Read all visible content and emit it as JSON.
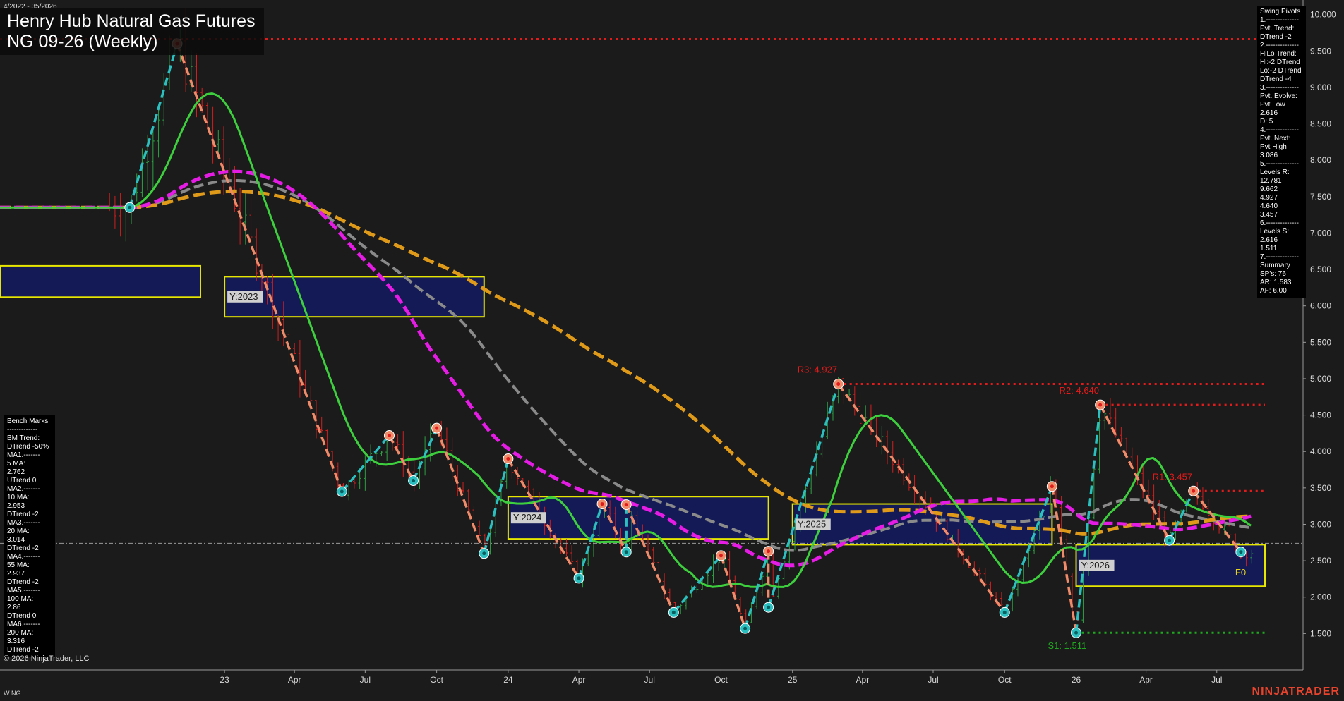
{
  "header": {
    "date_range": "4/2022 - 35/2026",
    "title_line1": "Henry Hub Natural Gas Futures",
    "title_line2": "NG 09-26 (Weekly)"
  },
  "footer": {
    "copyright": "© 2026 NinjaTrader, LLC",
    "instrument_tag": "W NG",
    "brand": "NINJATRADER"
  },
  "swing_pivots_panel": {
    "lines": [
      "Swing Pivots",
      "1.--------------",
      "Pvt. Trend:",
      "DTrend -2",
      "2.--------------",
      "HiLo Trend:",
      "Hi:-2 DTrend",
      "Lo:-2 DTrend",
      "DTrend -4",
      "3.--------------",
      "Pvt. Evolve:",
      "Pvt Low",
      "2.616",
      "D: 5",
      "4.--------------",
      "Pvt. Next:",
      "Pvt High",
      "3.086",
      "5.--------------",
      "Levels R:",
      "12.781",
      "9.662",
      "4.927",
      "4.640",
      "3.457",
      "6.--------------",
      "Levels S:",
      "2.616",
      "1.511",
      "7.--------------",
      "Summary",
      "SP's: 76",
      "AR: 1.583",
      "AF: 6.00"
    ]
  },
  "bench_marks_panel": {
    "lines": [
      "Bench Marks",
      "-------------",
      "BM Trend:",
      "DTrend -50%",
      "MA1.-------",
      "5 MA:",
      "2.762",
      "UTrend 0",
      "MA2.-------",
      "10 MA:",
      "2.953",
      "DTrend -2",
      "MA3.-------",
      "20 MA:",
      "3.014",
      "DTrend -2",
      "MA4.-------",
      "55 MA:",
      "2.937",
      "DTrend -2",
      "MA5.-------",
      "100 MA:",
      "2.86",
      "DTrend 0",
      "MA6.-------",
      "200 MA:",
      "3.316",
      "DTrend -2"
    ]
  },
  "chart_data": {
    "type": "candlestick",
    "x_ticks": [
      {
        "label": "23",
        "date": "2023-01"
      },
      {
        "label": "Apr",
        "date": "2023-04"
      },
      {
        "label": "Jul",
        "date": "2023-07"
      },
      {
        "label": "Oct",
        "date": "2023-10"
      },
      {
        "label": "24",
        "date": "2024-01"
      },
      {
        "label": "Apr",
        "date": "2024-04"
      },
      {
        "label": "Jul",
        "date": "2024-07"
      },
      {
        "label": "Oct",
        "date": "2024-10"
      },
      {
        "label": "25",
        "date": "2025-01"
      },
      {
        "label": "Apr",
        "date": "2025-04"
      },
      {
        "label": "Jul",
        "date": "2025-07"
      },
      {
        "label": "Oct",
        "date": "2025-10"
      },
      {
        "label": "26",
        "date": "2026-01"
      },
      {
        "label": "Apr",
        "date": "2026-04"
      },
      {
        "label": "Jul",
        "date": "2026-07"
      }
    ],
    "y_ticks": [
      "10.000",
      "9.500",
      "9.000",
      "8.500",
      "8.000",
      "7.500",
      "7.000",
      "6.500",
      "6.000",
      "5.500",
      "5.000",
      "4.500",
      "4.000",
      "3.500",
      "3.000",
      "2.500",
      "2.000",
      "1.500"
    ],
    "y_range": [
      1.0,
      10.2
    ],
    "last_price": 2.74,
    "swing_points": [
      {
        "date": "2022-09",
        "price": 7.35,
        "type": "low"
      },
      {
        "date": "2022-11",
        "price": 9.6,
        "type": "high"
      },
      {
        "date": "2023-06",
        "price": 3.45,
        "type": "low"
      },
      {
        "date": "2023-08",
        "price": 4.22,
        "type": "high"
      },
      {
        "date": "2023-09",
        "price": 3.6,
        "type": "low"
      },
      {
        "date": "2023-10",
        "price": 4.32,
        "type": "high"
      },
      {
        "date": "2023-12",
        "price": 2.6,
        "type": "low"
      },
      {
        "date": "2024-01",
        "price": 3.9,
        "type": "high"
      },
      {
        "date": "2024-04",
        "price": 2.26,
        "type": "low"
      },
      {
        "date": "2024-05",
        "price": 3.28,
        "type": "high"
      },
      {
        "date": "2024-06",
        "price": 2.62,
        "type": "low"
      },
      {
        "date": "2024-06",
        "price": 3.27,
        "type": "high"
      },
      {
        "date": "2024-08",
        "price": 1.79,
        "type": "low"
      },
      {
        "date": "2024-10",
        "price": 2.57,
        "type": "high"
      },
      {
        "date": "2024-11",
        "price": 1.57,
        "type": "low"
      },
      {
        "date": "2024-12",
        "price": 2.63,
        "type": "high"
      },
      {
        "date": "2024-12",
        "price": 1.86,
        "type": "low"
      },
      {
        "date": "2025-03",
        "price": 4.927,
        "type": "high"
      },
      {
        "date": "2025-10",
        "price": 1.79,
        "type": "low"
      },
      {
        "date": "2025-12",
        "price": 3.52,
        "type": "high"
      },
      {
        "date": "2026-01",
        "price": 1.511,
        "type": "low"
      },
      {
        "date": "2026-02",
        "price": 4.64,
        "type": "high"
      },
      {
        "date": "2026-05",
        "price": 2.78,
        "type": "low"
      },
      {
        "date": "2026-06",
        "price": 3.457,
        "type": "high"
      },
      {
        "date": "2026-08",
        "price": 2.62,
        "type": "low"
      }
    ],
    "resistance_levels": [
      {
        "label": "R3: 4.927",
        "value": 4.927
      },
      {
        "label": "R2: 4.640",
        "value": 4.64
      },
      {
        "label": "R1: 3.457",
        "value": 3.457
      }
    ],
    "top_resistance_value": 9.662,
    "support_levels": [
      {
        "label": "S1: 1.511",
        "value": 1.511
      }
    ],
    "yearly_boxes": [
      {
        "label": "",
        "date_start": "2022-04",
        "date_end": "2022-12",
        "high": 6.55,
        "low": 6.12
      },
      {
        "label": "Y:2023",
        "date_start": "2023-01",
        "date_end": "2023-12",
        "high": 6.4,
        "low": 5.85
      },
      {
        "label": "Y:2024",
        "date_start": "2024-01",
        "date_end": "2024-12",
        "high": 3.38,
        "low": 2.8
      },
      {
        "label": "Y:2025",
        "date_start": "2025-01",
        "date_end": "2025-12",
        "high": 3.28,
        "low": 2.72
      },
      {
        "label": "Y:2026",
        "date_start": "2026-01",
        "date_end": "2026-09",
        "high": 2.72,
        "low": 2.15
      }
    ],
    "forecast_marker": {
      "label": "F0",
      "date": "2026-08"
    },
    "colors": {
      "background": "#1b1b1b",
      "up_bar": "#2ea043",
      "down_bar": "#d11f1f",
      "ma_green": "#3ecf3e",
      "ma_magenta": "#e41ce4",
      "ma_orange": "#e09a1a",
      "ma_gray": "#8a8a8a",
      "swing_up": "#2bbfbf",
      "swing_down": "#f08b6a",
      "resistance": "#e01b1b",
      "support": "#1fa81f",
      "box_fill": "#141a5a",
      "box_border": "#e6e600"
    }
  }
}
